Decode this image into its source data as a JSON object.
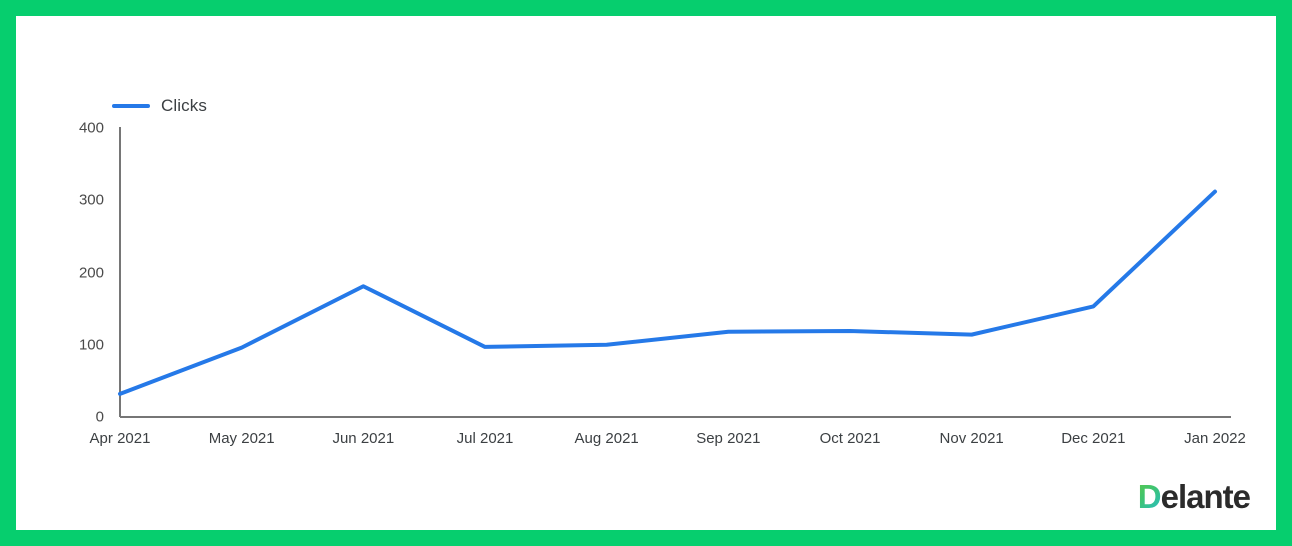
{
  "frame": {
    "border_color": "#06ce6e"
  },
  "legend": {
    "position": "top-left",
    "entries": [
      {
        "label": "Clicks",
        "color": "#2579e8"
      }
    ]
  },
  "logo": {
    "first_letter": "D",
    "rest": "elante"
  },
  "chart_data": {
    "type": "line",
    "title": "",
    "subtitle": "",
    "xlabel": "",
    "ylabel": "",
    "grid": false,
    "legend_position": "top-left",
    "line_color": "#2579e8",
    "axis_color": "#767676",
    "ylim": [
      0,
      400
    ],
    "yticks": [
      0,
      100,
      200,
      300,
      400
    ],
    "categories": [
      "Apr 2021",
      "May 2021",
      "Jun 2021",
      "Jul 2021",
      "Aug 2021",
      "Sep 2021",
      "Oct 2021",
      "Nov 2021",
      "Dec 2021",
      "Jan 2022"
    ],
    "series": [
      {
        "name": "Clicks",
        "color": "#2579e8",
        "values": [
          32,
          96,
          181,
          97,
          100,
          118,
          119,
          114,
          153,
          312
        ]
      }
    ]
  }
}
